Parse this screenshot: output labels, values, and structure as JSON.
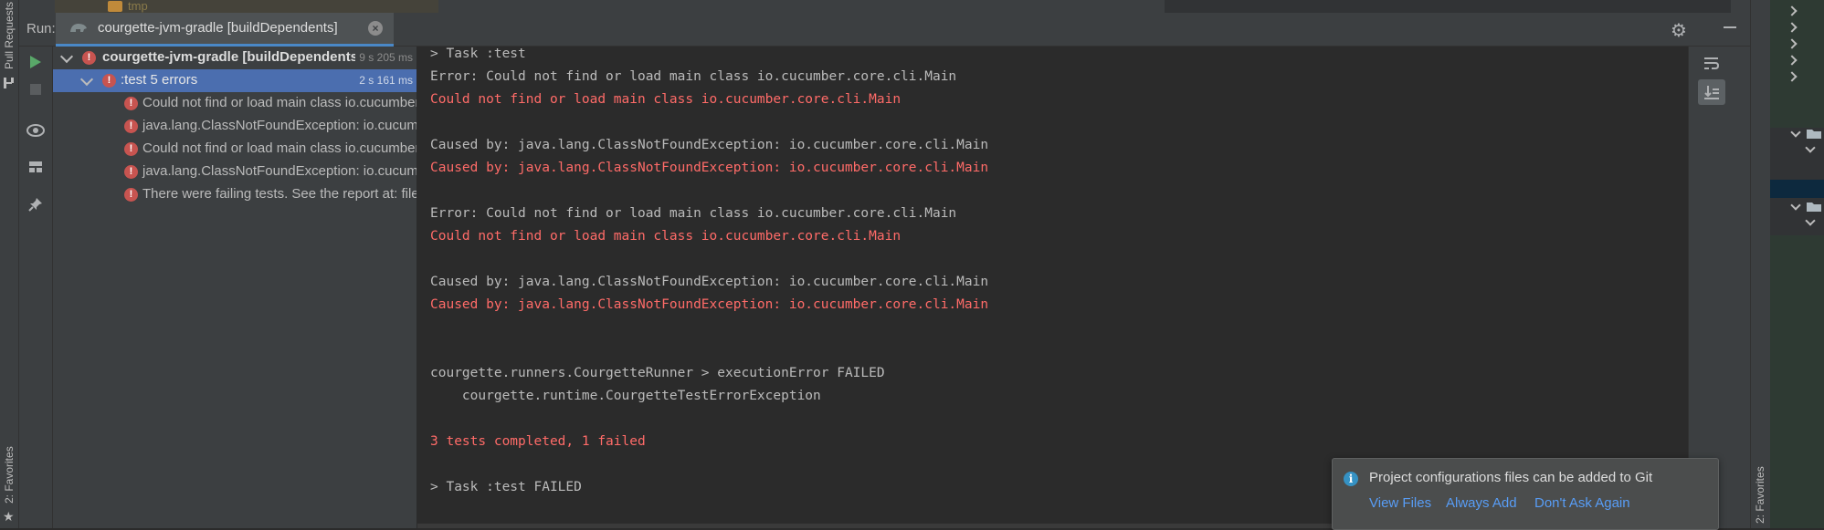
{
  "top": {
    "folder_label": "tmp"
  },
  "left_strip": {
    "pull_requests": "Pull Requests",
    "favorites": "2: Favorites"
  },
  "right_strip": {
    "favorites": "2: Favorites"
  },
  "run_window": {
    "label": "Run:",
    "tab_title": "courgette-jvm-gradle [buildDependents]",
    "tab_close": "×"
  },
  "tree": {
    "items": [
      {
        "label": "courgette-jvm-gradle [buildDependents]",
        "time": "9 s 205 ms"
      },
      {
        "label": ":test  5 errors",
        "time": "2 s 161 ms"
      },
      {
        "label": "Could not find or load main class io.cucumber.core.cli.Main"
      },
      {
        "label": "java.lang.ClassNotFoundException: io.cucumber.core.cli.Main"
      },
      {
        "label": "Could not find or load main class io.cucumber.core.cli.Main"
      },
      {
        "label": "java.lang.ClassNotFoundException: io.cucumber.core.cli.Main"
      },
      {
        "label": "There were failing tests. See the report at: file"
      }
    ]
  },
  "console": {
    "lines": [
      "> Task :test",
      "Error: Could not find or load main class io.cucumber.core.cli.Main",
      "Could not find or load main class io.cucumber.core.cli.Main",
      "Caused by: java.lang.ClassNotFoundException: io.cucumber.core.cli.Main",
      "Caused by: java.lang.ClassNotFoundException: io.cucumber.core.cli.Main",
      "Error: Could not find or load main class io.cucumber.core.cli.Main",
      "Could not find or load main class io.cucumber.core.cli.Main",
      "Caused by: java.lang.ClassNotFoundException: io.cucumber.core.cli.Main",
      "Caused by: java.lang.ClassNotFoundException: io.cucumber.core.cli.Main",
      "courgette.runners.CourgetteRunner > executionError FAILED",
      "    courgette.runtime.CourgetteTestErrorException",
      "3 tests completed, 1 failed",
      "> Task :test FAILED"
    ]
  },
  "notification": {
    "message": "Project configurations files can be added to Git",
    "actions": [
      "View Files",
      "Always Add",
      "Don't Ask Again"
    ]
  },
  "colors": {
    "error_text": "#ff6b68",
    "link": "#589df6",
    "selection": "#4b6eaf",
    "accent_tab": "#4a88c7"
  }
}
